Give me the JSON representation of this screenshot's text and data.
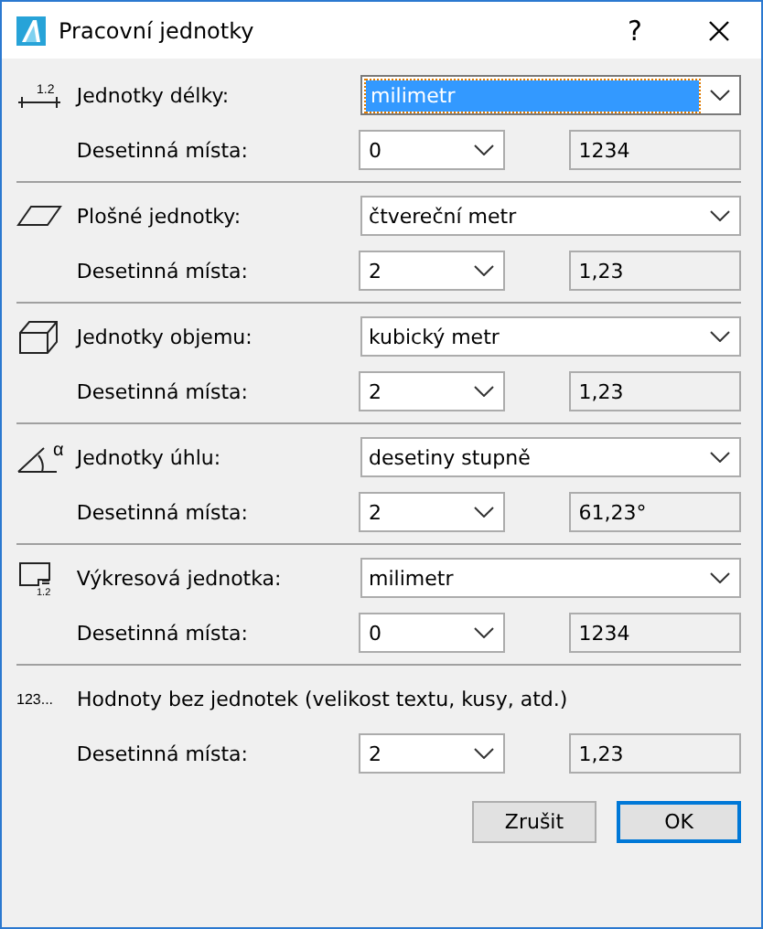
{
  "window": {
    "title": "Pracovní jednotky",
    "help": "?"
  },
  "sections": [
    {
      "kind": "length",
      "icon_text": "1.2",
      "label": "Jednotky délky:",
      "unit": "milimetr",
      "unit_focused": true,
      "decimals_label": "Desetinná místa:",
      "decimals": "0",
      "preview": "1234"
    },
    {
      "kind": "area",
      "label": "Plošné jednotky:",
      "unit": "čtvereční metr",
      "unit_focused": false,
      "decimals_label": "Desetinná místa:",
      "decimals": "2",
      "preview": "1,23"
    },
    {
      "kind": "volume",
      "label": "Jednotky objemu:",
      "unit": "kubický metr",
      "unit_focused": false,
      "decimals_label": "Desetinná místa:",
      "decimals": "2",
      "preview": "1,23"
    },
    {
      "kind": "angle",
      "icon_text": "α",
      "label": "Jednotky úhlu:",
      "unit": "desetiny stupně",
      "unit_focused": false,
      "decimals_label": "Desetinná místa:",
      "decimals": "2",
      "preview": "61,23°"
    },
    {
      "kind": "drawing",
      "icon_text": "1.2",
      "label": "Výkresová jednotka:",
      "unit": "milimetr",
      "unit_focused": false,
      "decimals_label": "Desetinná místa:",
      "decimals": "0",
      "preview": "1234"
    },
    {
      "kind": "text",
      "icon_text": "123...",
      "label": "Hodnoty bez jednotek (velikost textu, kusy, atd.)",
      "decimals_label": "Desetinná místa:",
      "decimals": "2",
      "preview": "1,23"
    }
  ],
  "buttons": [
    {
      "label": "Zrušit",
      "default": false
    },
    {
      "label": "OK",
      "default": true
    }
  ]
}
